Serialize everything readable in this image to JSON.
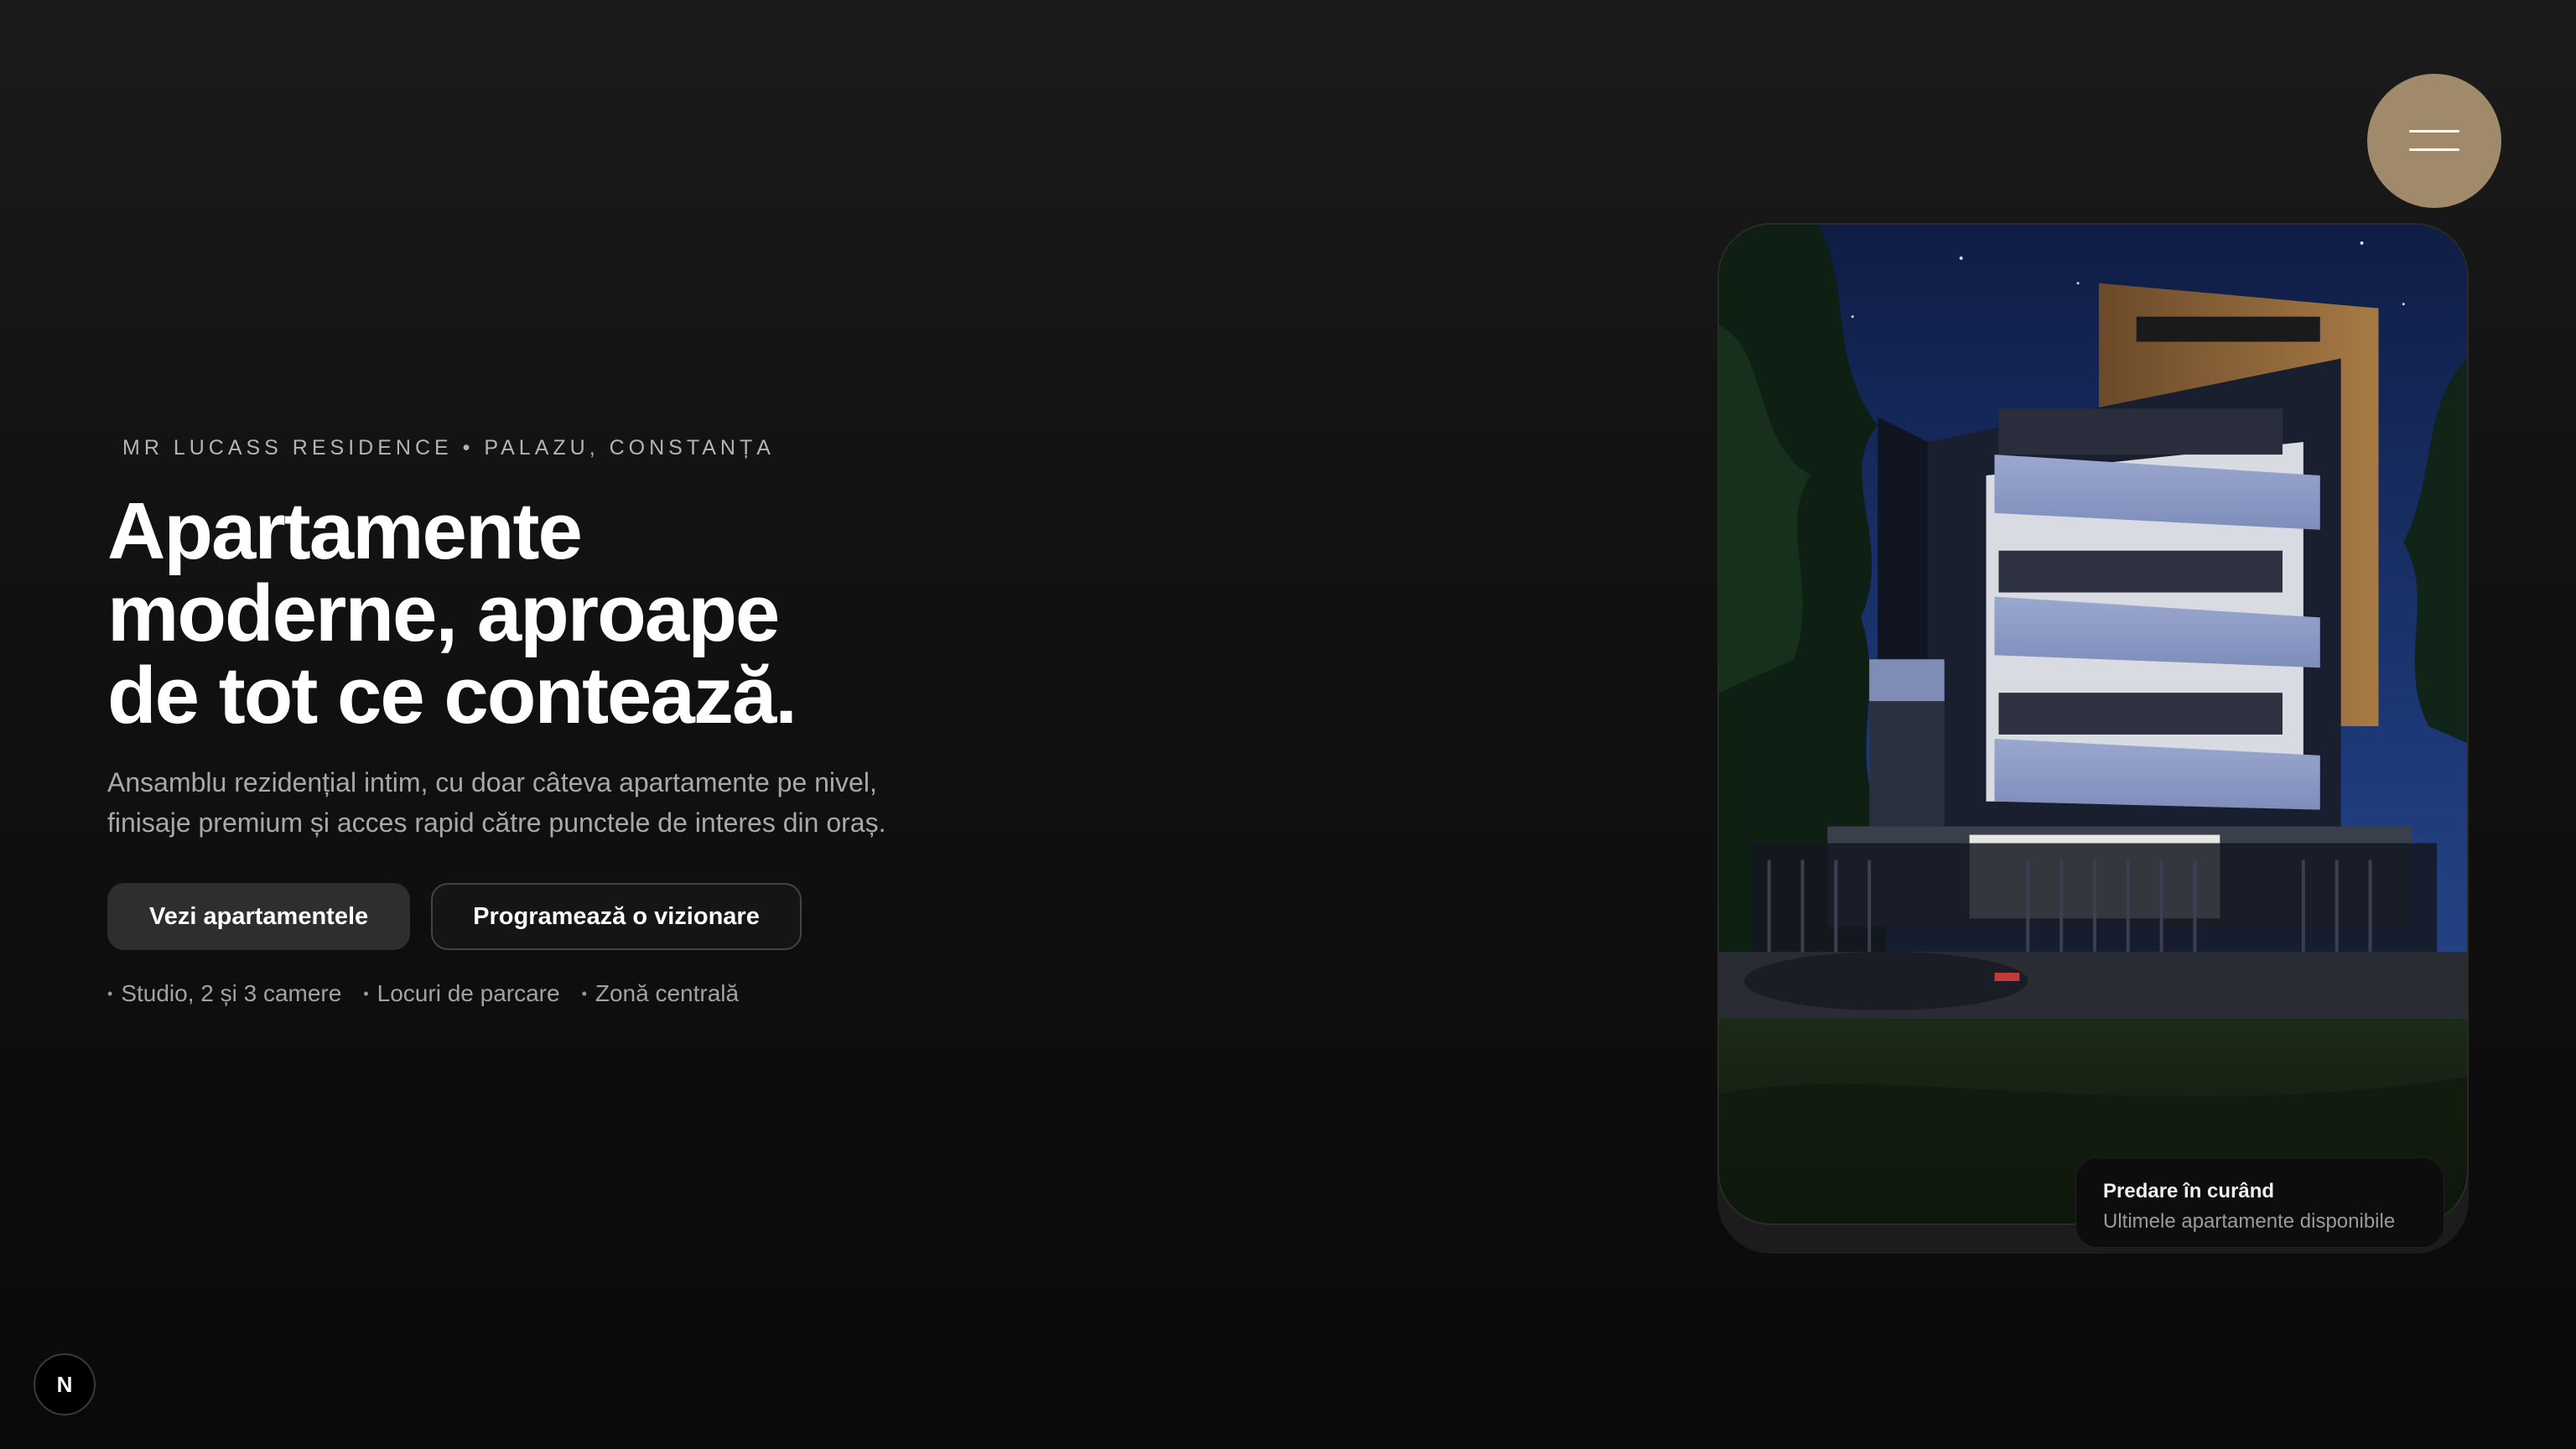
{
  "hero": {
    "eyebrow": "MR LUCASS RESIDENCE • PALAZU, CONSTANȚA",
    "title_lines": [
      "Apartamente",
      "moderne, aproape",
      "de tot ce contează."
    ],
    "subtitle_lines": [
      "Ansamblu rezidențial intim, cu doar câteva apartamente pe nivel,",
      "finisaje premium și acces rapid către punctele de interes din oraș."
    ],
    "primary_button": "Vezi apartamentele",
    "secondary_button": "Programează o vizionare",
    "features": [
      "Studio, 2 și 3 camere",
      "Locuri de parcare",
      "Zonă centrală"
    ]
  },
  "menu": {
    "icon": "hamburger-icon"
  },
  "status_card": {
    "title": "Predare în curând",
    "subtitle": "Ultimele apartamente disponibile"
  },
  "corner_badge": {
    "label": "N"
  },
  "colors": {
    "accent": "#a18a6c",
    "background": "#111111",
    "button_primary": "#2e2e2e"
  }
}
